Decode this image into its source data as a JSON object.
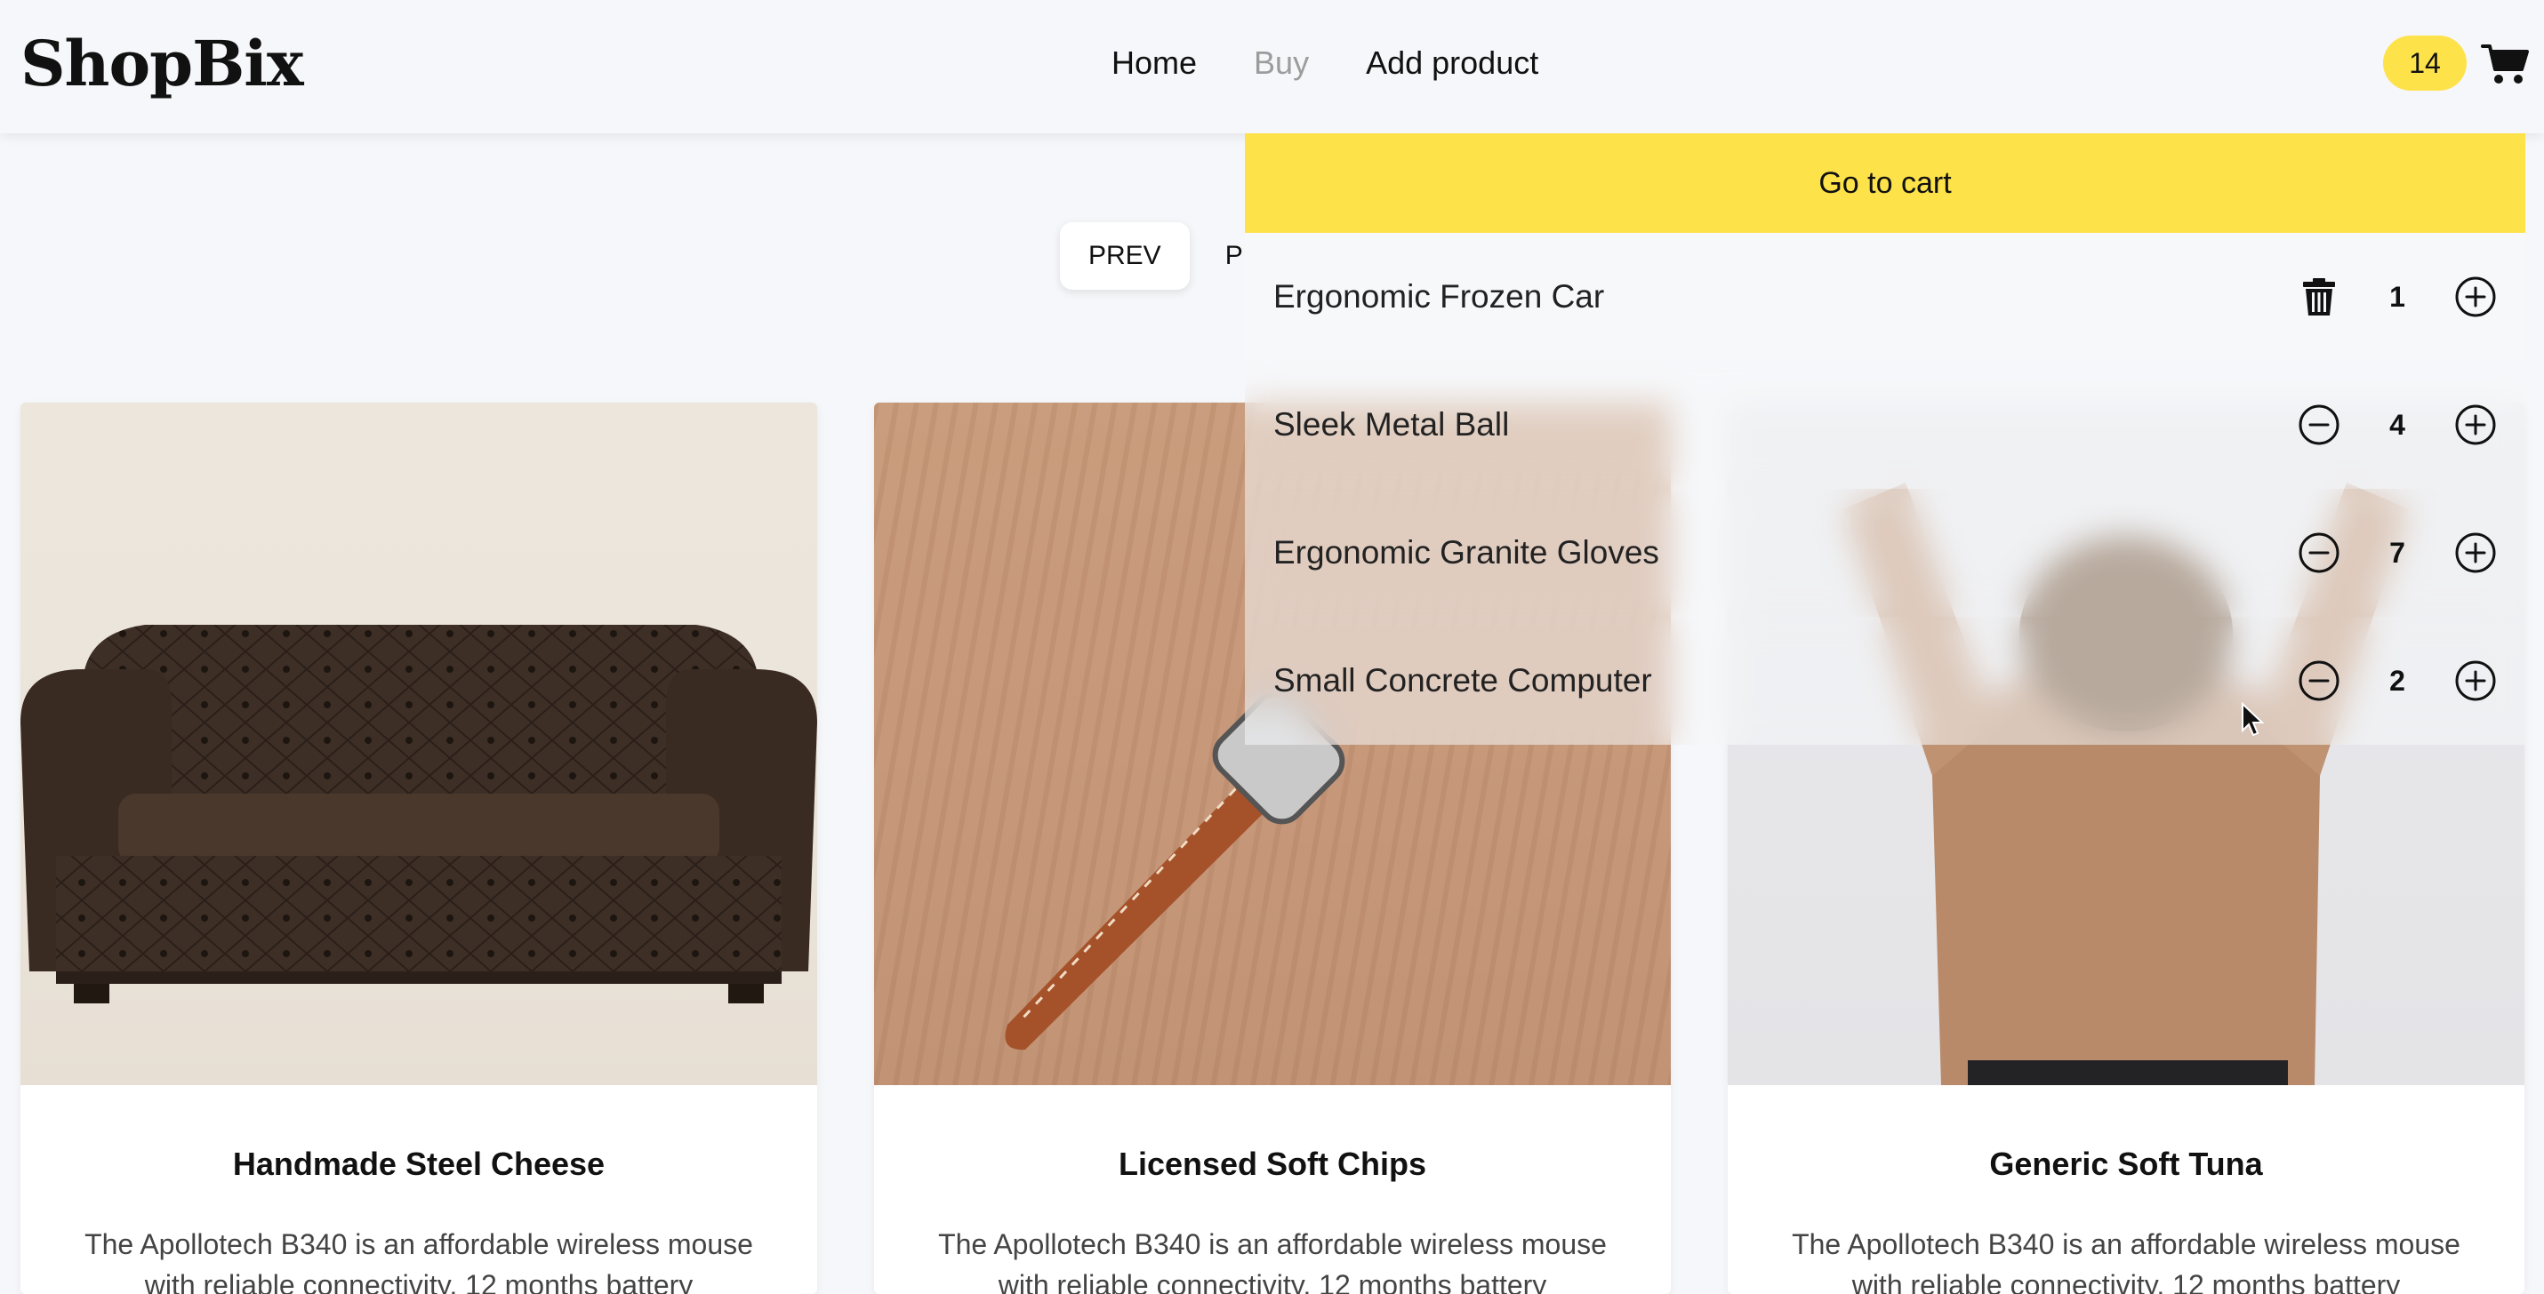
{
  "header": {
    "logo": "ShopBix",
    "nav": [
      {
        "label": "Home",
        "active": false
      },
      {
        "label": "Buy",
        "active": true
      },
      {
        "label": "Add product",
        "active": false
      }
    ],
    "cart_count": "14",
    "cart_icon": "shopping-cart-icon"
  },
  "pager": {
    "prev_label": "PREV",
    "visible_page_label": "P"
  },
  "products": [
    {
      "title": "Handmade Steel Cheese",
      "description": "The Apollotech B340 is an affordable wireless mouse with reliable connectivity, 12 months battery",
      "image": "leather-sofa-photo"
    },
    {
      "title": "Licensed Soft Chips",
      "description": "The Apollotech B340 is an affordable wireless mouse with reliable connectivity, 12 months battery",
      "image": "watch-on-wood-photo"
    },
    {
      "title": "Generic Soft Tuna",
      "description": "The Apollotech B340 is an affordable wireless mouse with reliable connectivity, 12 months battery",
      "image": "person-in-tan-sweater-photo"
    }
  ],
  "cart_panel": {
    "go_to_cart_label": "Go to cart",
    "items": [
      {
        "name": "Ergonomic Frozen Car",
        "qty": "1",
        "decrease_icon": "trash-icon"
      },
      {
        "name": "Sleek Metal Ball",
        "qty": "4",
        "decrease_icon": "minus-circle-icon"
      },
      {
        "name": "Ergonomic Granite Gloves",
        "qty": "7",
        "decrease_icon": "minus-circle-icon"
      },
      {
        "name": "Small Concrete Computer",
        "qty": "2",
        "decrease_icon": "minus-circle-icon"
      }
    ]
  },
  "colors": {
    "accent_yellow": "#fde24a",
    "background": "#f6f7fa",
    "muted_nav": "#9c9c9c"
  }
}
